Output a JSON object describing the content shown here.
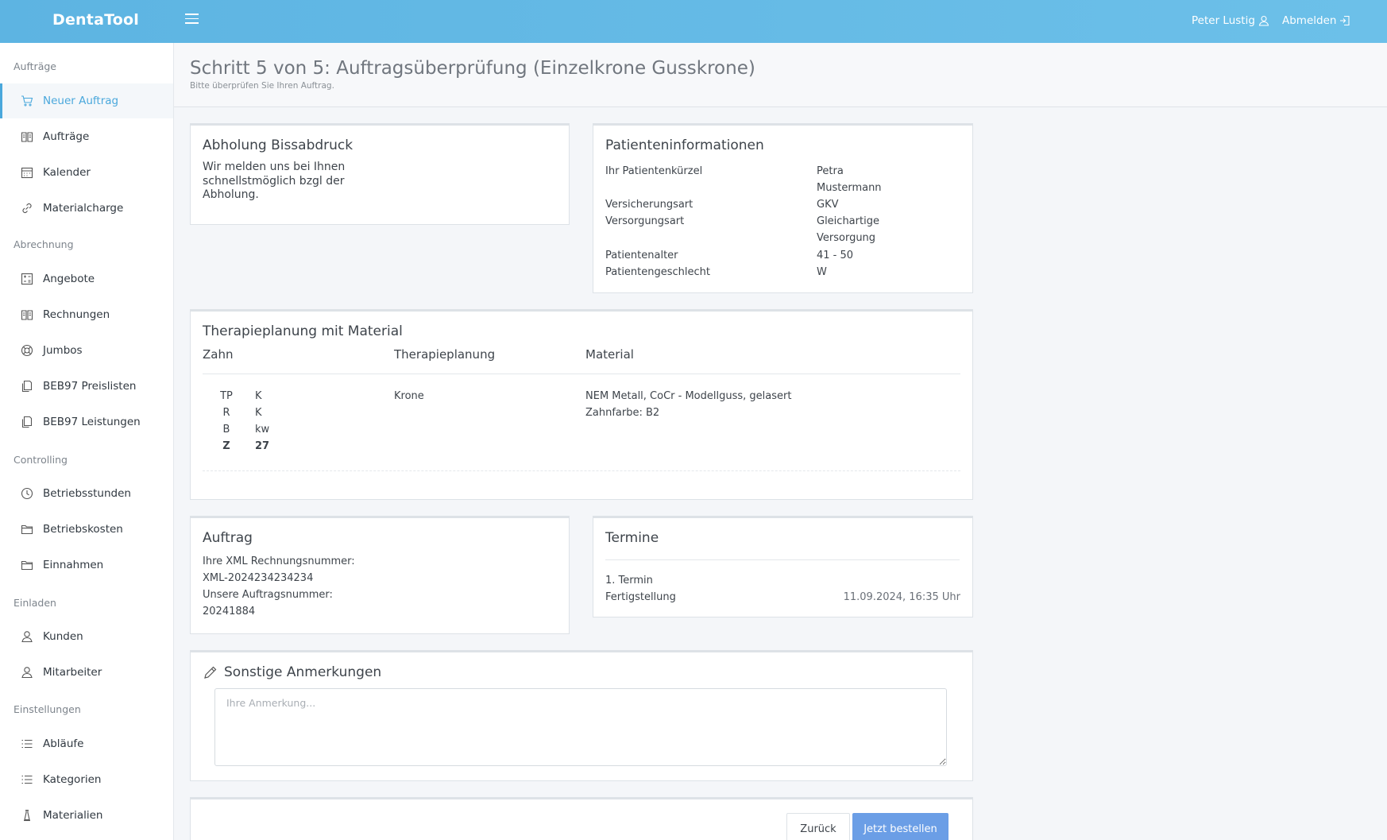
{
  "app": {
    "brand": "DentaTool",
    "user_name": "Peter Lustig",
    "logout_label": "Abmelden"
  },
  "sidebar": {
    "sections": [
      "Aufträge",
      "Abrechnung",
      "Controlling",
      "Einladen",
      "Einstellungen"
    ],
    "items": [
      {
        "label": "Neuer Auftrag",
        "icon": "cart-icon"
      },
      {
        "label": "Aufträge",
        "icon": "book-icon"
      },
      {
        "label": "Kalender",
        "icon": "calendar-icon"
      },
      {
        "label": "Materialcharge",
        "icon": "link-icon"
      },
      {
        "label": "Angebote",
        "icon": "calculator-icon"
      },
      {
        "label": "Rechnungen",
        "icon": "book-icon"
      },
      {
        "label": "Jumbos",
        "icon": "lifebuoy-icon"
      },
      {
        "label": "BEB97 Preislisten",
        "icon": "copy-icon"
      },
      {
        "label": "BEB97 Leistungen",
        "icon": "copy-icon"
      },
      {
        "label": "Betriebsstunden",
        "icon": "clock-icon"
      },
      {
        "label": "Betriebskosten",
        "icon": "folder-icon"
      },
      {
        "label": "Einnahmen",
        "icon": "folder-icon"
      },
      {
        "label": "Kunden",
        "icon": "user-icon"
      },
      {
        "label": "Mitarbeiter",
        "icon": "user-icon"
      },
      {
        "label": "Abläufe",
        "icon": "list-icon"
      },
      {
        "label": "Kategorien",
        "icon": "list-icon"
      },
      {
        "label": "Materialien",
        "icon": "flask-icon"
      }
    ]
  },
  "page": {
    "title": "Schritt 5 von 5: Auftragsüberprüfung (Einzelkrone Gusskrone)",
    "subtitle": "Bitte überprüfen Sie Ihren Auftrag."
  },
  "pickup": {
    "title": "Abholung Bissabdruck",
    "text_lines": [
      "Wir melden uns bei Ihnen",
      "schnellstmöglich bzgl der",
      "Abholung."
    ]
  },
  "patient": {
    "title": "Patienteninformationen",
    "rows": [
      {
        "label": "Ihr Patientenkürzel",
        "value_lines": [
          "Petra",
          "Mustermann"
        ]
      },
      {
        "label": "Versicherungsart",
        "value_lines": [
          "GKV"
        ]
      },
      {
        "label": "Versorgungsart",
        "value_lines": [
          "Gleichartige",
          "Versorgung"
        ]
      },
      {
        "label": "Patientenalter",
        "value_lines": [
          "41 - 50"
        ]
      },
      {
        "label": "Patientengeschlecht",
        "value_lines": [
          "W"
        ]
      }
    ]
  },
  "therapy": {
    "title": "Therapieplanung mit Material",
    "col_tooth": "Zahn",
    "col_plan": "Therapieplanung",
    "col_material": "Material",
    "tooth_rows": [
      {
        "key": "TP",
        "value": "K"
      },
      {
        "key": "R",
        "value": "K"
      },
      {
        "key": "B",
        "value": "kw"
      },
      {
        "key": "Z",
        "value": "27"
      }
    ],
    "plan": "Krone",
    "material_lines": [
      "NEM Metall, CoCr - Modellguss, gelasert",
      "Zahnfarbe: B2"
    ]
  },
  "order": {
    "title": "Auftrag",
    "lines": [
      "Ihre XML Rechnungsnummer:",
      "XML-2024234234234",
      "Unsere Auftragsnummer:",
      "20241884"
    ]
  },
  "dates": {
    "title": "Termine",
    "item_label": "1. Termin",
    "event_label": "Fertigstellung",
    "event_value": "11.09.2024, 16:35 Uhr"
  },
  "notes": {
    "title": "Sonstige Anmerkungen",
    "placeholder": "Ihre Anmerkung..."
  },
  "actions": {
    "back_label": "Zurück",
    "order_label": "Jetzt bestellen"
  },
  "colors": {
    "topbar": "#5db4e2",
    "accent": "#4aa8dc",
    "primary_button": "#6b9ee6"
  }
}
